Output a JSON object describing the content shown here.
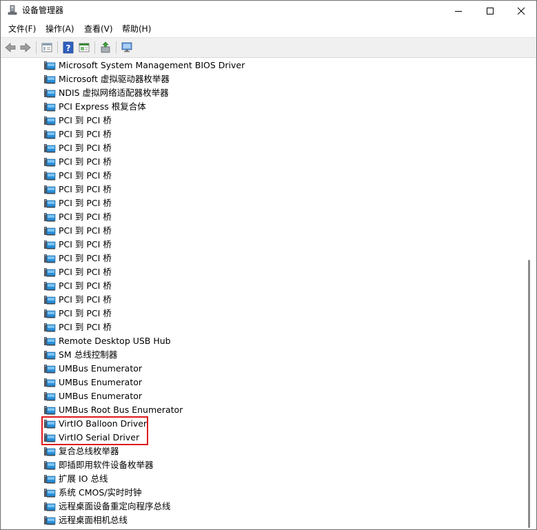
{
  "window": {
    "title": "设备管理器"
  },
  "menu": [
    "文件(F)",
    "操作(A)",
    "查看(V)",
    "帮助(H)"
  ],
  "devices": [
    "Microsoft System Management BIOS Driver",
    "Microsoft 虚拟驱动器枚举器",
    "NDIS 虚拟网络适配器枚举器",
    "PCI Express 根复合体",
    "PCI 到 PCI 桥",
    "PCI 到 PCI 桥",
    "PCI 到 PCI 桥",
    "PCI 到 PCI 桥",
    "PCI 到 PCI 桥",
    "PCI 到 PCI 桥",
    "PCI 到 PCI 桥",
    "PCI 到 PCI 桥",
    "PCI 到 PCI 桥",
    "PCI 到 PCI 桥",
    "PCI 到 PCI 桥",
    "PCI 到 PCI 桥",
    "PCI 到 PCI 桥",
    "PCI 到 PCI 桥",
    "PCI 到 PCI 桥",
    "PCI 到 PCI 桥",
    "Remote Desktop USB Hub",
    "SM 总线控制器",
    "UMBus Enumerator",
    "UMBus Enumerator",
    "UMBus Enumerator",
    "UMBus Root Bus Enumerator",
    "VirtIO Balloon Driver",
    "VirtIO Serial Driver",
    "复合总线枚举器",
    "即插即用软件设备枚举器",
    "扩展 IO 总线",
    "系统 CMOS/实时时钟",
    "远程桌面设备重定向程序总线",
    "远程桌面相机总线"
  ],
  "icons": {
    "device": "system-device-icon",
    "app": "device-manager-icon"
  },
  "colors": {
    "highlight": "#e0191b",
    "icon_blue": "#2a8fd9"
  }
}
